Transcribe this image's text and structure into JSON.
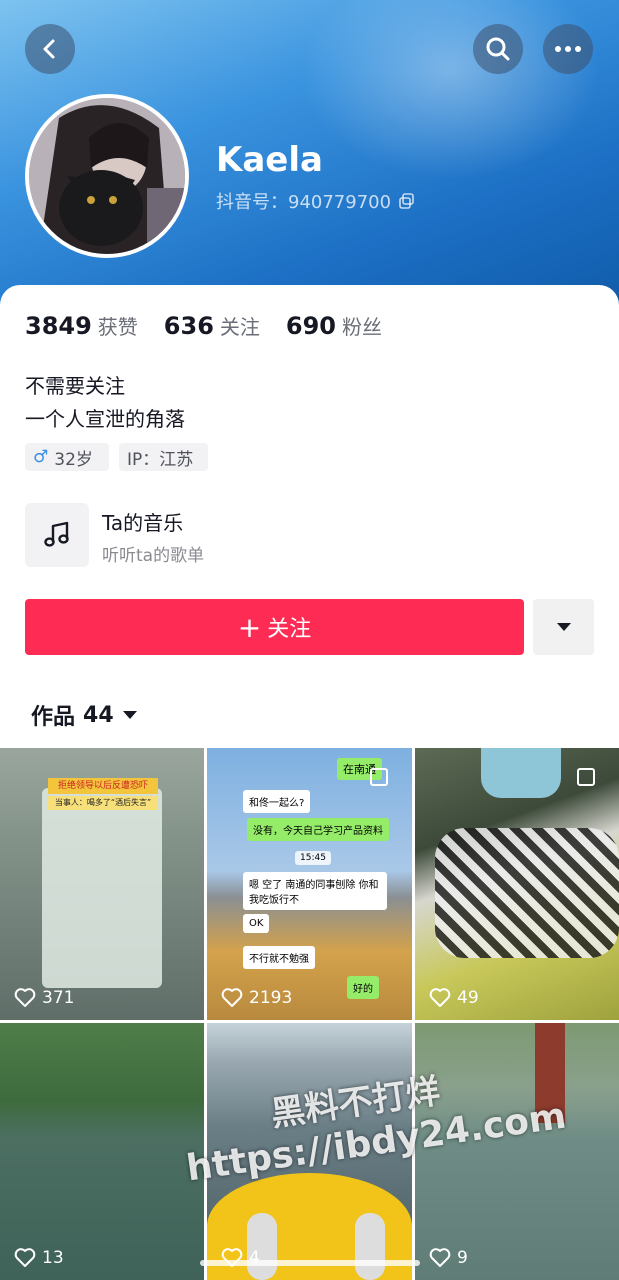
{
  "header": {
    "name": "Kaela",
    "douyin_id_label": "抖音号：",
    "douyin_id": "940779700"
  },
  "stats": [
    {
      "num": "3849",
      "label": "获赞"
    },
    {
      "num": "636",
      "label": "关注"
    },
    {
      "num": "690",
      "label": "粉丝"
    }
  ],
  "bio": {
    "line1": "不需要关注",
    "line2": "一个人宣泄的角落"
  },
  "tags": {
    "gender_age": "32岁",
    "gender_symbol": "♂",
    "ip": "IP：江苏"
  },
  "music": {
    "title": "Ta的音乐",
    "subtitle": "听听ta的歌单"
  },
  "actions": {
    "follow_label": "关注",
    "follow_plus": "+"
  },
  "works": {
    "label": "作品",
    "count": "44"
  },
  "videos": [
    {
      "likes": "371",
      "caption_top": "拒绝领导以后反遭恐吓",
      "caption_sub": "当事人：喝多了“酒后失言”"
    },
    {
      "likes": "2193",
      "chat": [
        "在南通",
        "和佟一起么?",
        "没有，今天自己学习产品资料",
        "15:45",
        "嗯 空了 南通的同事刨除 你和我吃饭行不",
        "OK",
        "不行就不勉强",
        "好的"
      ]
    },
    {
      "likes": "49"
    },
    {
      "likes": "13"
    },
    {
      "likes": "4"
    },
    {
      "likes": "9"
    }
  ],
  "watermark": {
    "line1": "黑料不打烊",
    "line2": "https://ibdy24.com"
  },
  "colors": {
    "accent": "#fe2c55",
    "header_blue": "#1c6fc4"
  }
}
